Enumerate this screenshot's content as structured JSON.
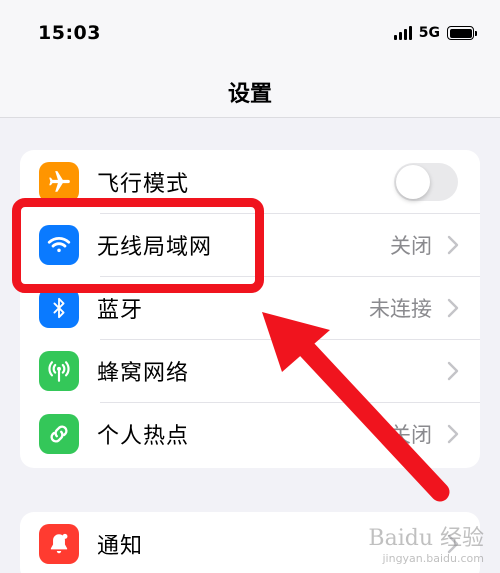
{
  "status_bar": {
    "time": "15:03",
    "network": "5G"
  },
  "nav": {
    "title": "设置"
  },
  "settings_group_1": [
    {
      "label": "飞行模式",
      "icon": "airplane-icon",
      "icon_color": "#ff9500",
      "toggle_on": false
    },
    {
      "label": "无线局域网",
      "icon": "wifi-icon",
      "icon_color": "#0a7aff",
      "value": "关闭"
    },
    {
      "label": "蓝牙",
      "icon": "bluetooth-icon",
      "icon_color": "#0a7aff",
      "value": "未连接"
    },
    {
      "label": "蜂窝网络",
      "icon": "antenna-icon",
      "icon_color": "#34c759"
    },
    {
      "label": "个人热点",
      "icon": "hotspot-link-icon",
      "icon_color": "#34c759",
      "value": "关闭"
    }
  ],
  "settings_group_2": [
    {
      "label": "通知",
      "icon": "bell-icon",
      "icon_color": "#ff3b30"
    }
  ],
  "annotation": {
    "highlight_color": "#f0141e",
    "arrow_color": "#f0141e"
  },
  "watermark": {
    "brand": "Baidu 经验",
    "url": "jingyan.baidu.com"
  }
}
